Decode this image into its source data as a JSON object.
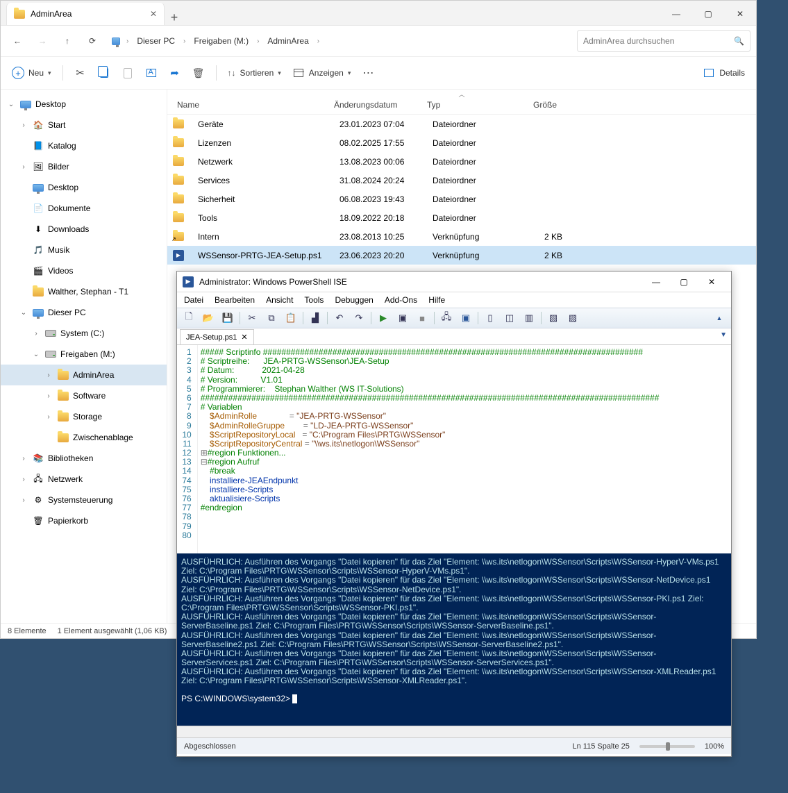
{
  "explorer": {
    "tab_title": "AdminArea",
    "tab_close": "✕",
    "tab_add": "+",
    "window_min": "—",
    "window_max": "▢",
    "window_close": "✕",
    "breadcrumbs": [
      "Dieser PC",
      "Freigaben (M:)",
      "AdminArea"
    ],
    "search_placeholder": "AdminArea durchsuchen",
    "toolbar": {
      "new": "Neu",
      "sort": "Sortieren",
      "view": "Anzeigen",
      "details": "Details"
    },
    "columns": {
      "name": "Name",
      "date": "Änderungsdatum",
      "type": "Typ",
      "size": "Größe"
    },
    "rows": [
      {
        "name": "Geräte",
        "date": "23.01.2023 07:04",
        "type": "Dateiordner",
        "size": "",
        "kind": "folder"
      },
      {
        "name": "Lizenzen",
        "date": "08.02.2025 17:55",
        "type": "Dateiordner",
        "size": "",
        "kind": "folder"
      },
      {
        "name": "Netzwerk",
        "date": "13.08.2023 00:06",
        "type": "Dateiordner",
        "size": "",
        "kind": "folder"
      },
      {
        "name": "Services",
        "date": "31.08.2024 20:24",
        "type": "Dateiordner",
        "size": "",
        "kind": "folder"
      },
      {
        "name": "Sicherheit",
        "date": "06.08.2023 19:43",
        "type": "Dateiordner",
        "size": "",
        "kind": "folder"
      },
      {
        "name": "Tools",
        "date": "18.09.2022 20:18",
        "type": "Dateiordner",
        "size": "",
        "kind": "folder"
      },
      {
        "name": "Intern",
        "date": "23.08.2013 10:25",
        "type": "Verknüpfung",
        "size": "2 KB",
        "kind": "link"
      },
      {
        "name": "WSSensor-PRTG-JEA-Setup.ps1",
        "date": "23.06.2023 20:20",
        "type": "Verknüpfung",
        "size": "2 KB",
        "kind": "ps1",
        "sel": true
      }
    ],
    "tree": [
      {
        "ind": 0,
        "tw": "v",
        "ico": "monitor",
        "label": "Desktop"
      },
      {
        "ind": 1,
        "tw": ">",
        "ico": "home",
        "label": "Start"
      },
      {
        "ind": 1,
        "tw": "",
        "ico": "katalog",
        "label": "Katalog"
      },
      {
        "ind": 1,
        "tw": ">",
        "ico": "pic",
        "label": "Bilder"
      },
      {
        "ind": 1,
        "tw": "",
        "ico": "monitor",
        "label": "Desktop"
      },
      {
        "ind": 1,
        "tw": "",
        "ico": "doc",
        "label": "Dokumente"
      },
      {
        "ind": 1,
        "tw": "",
        "ico": "down",
        "label": "Downloads"
      },
      {
        "ind": 1,
        "tw": "",
        "ico": "music",
        "label": "Musik"
      },
      {
        "ind": 1,
        "tw": "",
        "ico": "video",
        "label": "Videos"
      },
      {
        "ind": 1,
        "tw": "",
        "ico": "folder",
        "label": "Walther, Stephan - T1"
      },
      {
        "ind": 1,
        "tw": "v",
        "ico": "monitor",
        "label": "Dieser PC"
      },
      {
        "ind": 2,
        "tw": ">",
        "ico": "drive",
        "label": "System (C:)"
      },
      {
        "ind": 2,
        "tw": "v",
        "ico": "drive",
        "label": "Freigaben (M:)"
      },
      {
        "ind": 3,
        "tw": ">",
        "ico": "folder",
        "label": "AdminArea",
        "sel": true
      },
      {
        "ind": 3,
        "tw": ">",
        "ico": "folder",
        "label": "Software"
      },
      {
        "ind": 3,
        "tw": ">",
        "ico": "folder",
        "label": "Storage"
      },
      {
        "ind": 3,
        "tw": "",
        "ico": "folder",
        "label": "Zwischenablage"
      },
      {
        "ind": 1,
        "tw": ">",
        "ico": "lib",
        "label": "Bibliotheken"
      },
      {
        "ind": 1,
        "tw": ">",
        "ico": "net",
        "label": "Netzwerk"
      },
      {
        "ind": 1,
        "tw": ">",
        "ico": "ctrl",
        "label": "Systemsteuerung"
      },
      {
        "ind": 1,
        "tw": "",
        "ico": "bin",
        "label": "Papierkorb"
      }
    ],
    "status_count": "8 Elemente",
    "status_sel": "1 Element ausgewählt (1,06 KB)"
  },
  "ise": {
    "title": "Administrator: Windows PowerShell ISE",
    "menu": [
      "Datei",
      "Bearbeiten",
      "Ansicht",
      "Tools",
      "Debuggen",
      "Add-Ons",
      "Hilfe"
    ],
    "tab": "JEA-Setup.ps1",
    "tab_x": "✕",
    "code_lines": [
      {
        "n": "1",
        "seg": [
          {
            "c": "c-green",
            "t": "##### Scriptinfo ##################################################################################"
          }
        ]
      },
      {
        "n": "2",
        "seg": [
          {
            "c": "c-green",
            "t": "# Scriptreihe:      JEA-PRTG-WSSensor\\JEA-Setup"
          }
        ]
      },
      {
        "n": "3",
        "seg": [
          {
            "c": "c-green",
            "t": "# Datum:            2021-04-28"
          }
        ]
      },
      {
        "n": "4",
        "seg": [
          {
            "c": "c-green",
            "t": "# Version:          V1.01"
          }
        ]
      },
      {
        "n": "5",
        "seg": [
          {
            "c": "c-green",
            "t": "# Programmierer:    Stephan Walther (WS IT-Solutions)"
          }
        ]
      },
      {
        "n": "6",
        "seg": [
          {
            "c": "c-green",
            "t": "###################################################################################################"
          }
        ]
      },
      {
        "n": "7",
        "seg": [
          {
            "c": "",
            "t": ""
          }
        ]
      },
      {
        "n": "8",
        "seg": [
          {
            "c": "c-green",
            "t": "# Variablen"
          }
        ]
      },
      {
        "n": "9",
        "seg": [
          {
            "c": "c-orange",
            "t": "    $AdminRolle              "
          },
          {
            "c": "c-grey",
            "t": "= "
          },
          {
            "c": "c-brown",
            "t": "\"JEA-PRTG-WSSensor\""
          }
        ]
      },
      {
        "n": "10",
        "seg": [
          {
            "c": "c-orange",
            "t": "    $AdminRolleGruppe        "
          },
          {
            "c": "c-grey",
            "t": "= "
          },
          {
            "c": "c-brown",
            "t": "\"LD-JEA-PRTG-WSSensor\""
          }
        ]
      },
      {
        "n": "11",
        "seg": [
          {
            "c": "c-orange",
            "t": "    $ScriptRepositoryLocal   "
          },
          {
            "c": "c-grey",
            "t": "= "
          },
          {
            "c": "c-brown",
            "t": "\"C:\\Program Files\\PRTG\\WSSensor\""
          }
        ]
      },
      {
        "n": "12",
        "seg": [
          {
            "c": "c-orange",
            "t": "    $ScriptRepositoryCentral "
          },
          {
            "c": "c-grey",
            "t": "= "
          },
          {
            "c": "c-brown",
            "t": "\"\\\\ws.its\\netlogon\\WSSensor\""
          }
        ]
      },
      {
        "n": "13",
        "seg": [
          {
            "c": "",
            "t": ""
          }
        ]
      },
      {
        "n": "14",
        "seg": [
          {
            "c": "c-grey",
            "t": "⊞"
          },
          {
            "c": "c-green",
            "t": "#region Funktionen..."
          }
        ]
      },
      {
        "n": "74",
        "seg": [
          {
            "c": "",
            "t": ""
          }
        ]
      },
      {
        "n": "75",
        "seg": [
          {
            "c": "c-grey",
            "t": "⊟"
          },
          {
            "c": "c-green",
            "t": "#region Aufruf"
          }
        ]
      },
      {
        "n": "76",
        "seg": [
          {
            "c": "c-green",
            "t": "    #break"
          }
        ]
      },
      {
        "n": "77",
        "seg": [
          {
            "c": "c-blue",
            "t": "    installiere-JEAEndpunkt"
          }
        ]
      },
      {
        "n": "78",
        "seg": [
          {
            "c": "c-blue",
            "t": "    installiere-Scripts"
          }
        ]
      },
      {
        "n": "79",
        "seg": [
          {
            "c": "c-blue",
            "t": "    aktualisiere-Scripts"
          }
        ]
      },
      {
        "n": "80",
        "seg": [
          {
            "c": "c-green",
            "t": "#endregion"
          }
        ]
      }
    ],
    "console": [
      "AUSFÜHRLICH: Ausführen des Vorgangs \"Datei kopieren\" für das Ziel \"Element: \\\\ws.its\\netlogon\\WSSensor\\Scripts\\WSSensor-HyperV-VMs.ps1 Ziel: C:\\Program Files\\PRTG\\WSSensor\\Scripts\\WSSensor-HyperV-VMs.ps1\".",
      "AUSFÜHRLICH: Ausführen des Vorgangs \"Datei kopieren\" für das Ziel \"Element: \\\\ws.its\\netlogon\\WSSensor\\Scripts\\WSSensor-NetDevice.ps1 Ziel: C:\\Program Files\\PRTG\\WSSensor\\Scripts\\WSSensor-NetDevice.ps1\".",
      "AUSFÜHRLICH: Ausführen des Vorgangs \"Datei kopieren\" für das Ziel \"Element: \\\\ws.its\\netlogon\\WSSensor\\Scripts\\WSSensor-PKI.ps1 Ziel: C:\\Program Files\\PRTG\\WSSensor\\Scripts\\WSSensor-PKI.ps1\".",
      "AUSFÜHRLICH: Ausführen des Vorgangs \"Datei kopieren\" für das Ziel \"Element: \\\\ws.its\\netlogon\\WSSensor\\Scripts\\WSSensor-ServerBaseline.ps1 Ziel: C:\\Program Files\\PRTG\\WSSensor\\Scripts\\WSSensor-ServerBaseline.ps1\".",
      "AUSFÜHRLICH: Ausführen des Vorgangs \"Datei kopieren\" für das Ziel \"Element: \\\\ws.its\\netlogon\\WSSensor\\Scripts\\WSSensor-ServerBaseline2.ps1 Ziel: C:\\Program Files\\PRTG\\WSSensor\\Scripts\\WSSensor-ServerBaseline2.ps1\".",
      "AUSFÜHRLICH: Ausführen des Vorgangs \"Datei kopieren\" für das Ziel \"Element: \\\\ws.its\\netlogon\\WSSensor\\Scripts\\WSSensor-ServerServices.ps1 Ziel: C:\\Program Files\\PRTG\\WSSensor\\Scripts\\WSSensor-ServerServices.ps1\".",
      "AUSFÜHRLICH: Ausführen des Vorgangs \"Datei kopieren\" für das Ziel \"Element: \\\\ws.its\\netlogon\\WSSensor\\Scripts\\WSSensor-XMLReader.ps1 Ziel: C:\\Program Files\\PRTG\\WSSensor\\Scripts\\WSSensor-XMLReader.ps1\"."
    ],
    "prompt": "PS C:\\WINDOWS\\system32> ",
    "status_left": "Abgeschlossen",
    "status_pos": "Ln 115  Spalte 25",
    "zoom": "100%"
  }
}
